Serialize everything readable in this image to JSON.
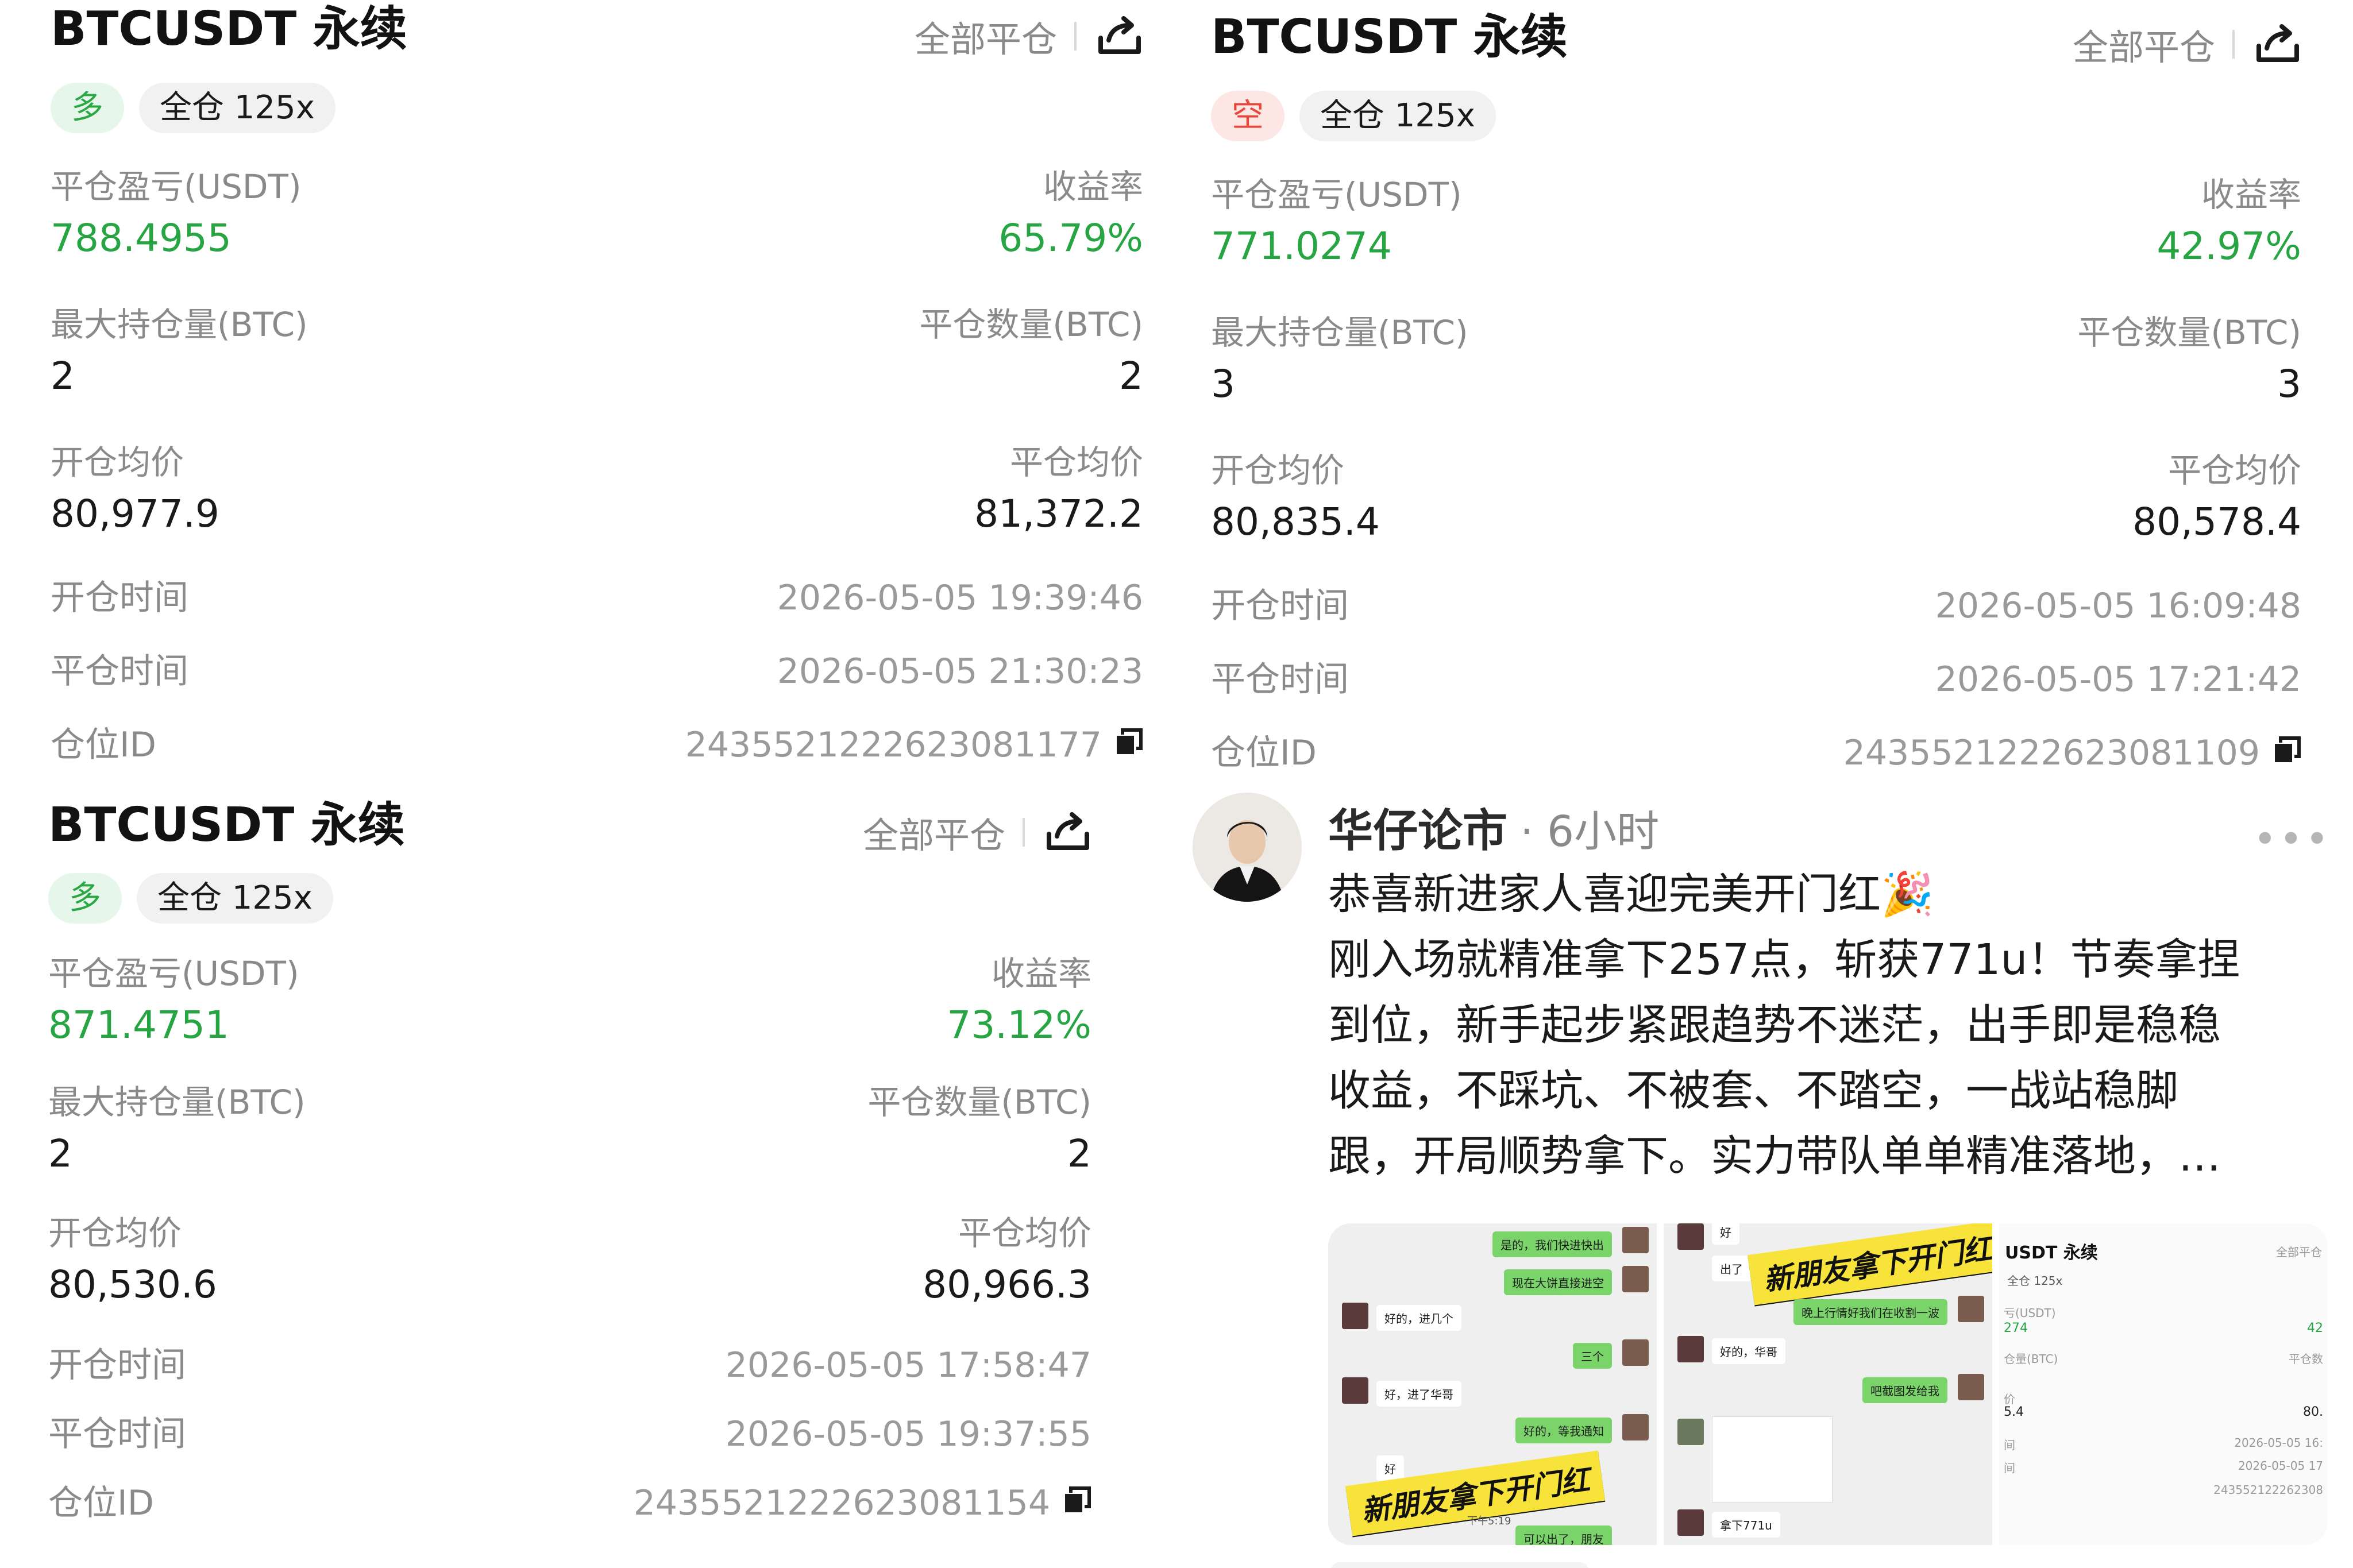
{
  "positions": [
    {
      "title": "BTCUSDT 永续",
      "close_all": "全部平仓",
      "side": "多",
      "mode": "全仓 125x",
      "pnl_label": "平仓盈亏(USDT)",
      "pnl_value": "788.4955",
      "roi_label": "收益率",
      "roi_value": "65.79%",
      "max_pos_label": "最大持仓量(BTC)",
      "max_pos_value": "2",
      "close_qty_label": "平仓数量(BTC)",
      "close_qty_value": "2",
      "open_avg_label": "开仓均价",
      "open_avg_value": "80,977.9",
      "close_avg_label": "平仓均价",
      "close_avg_value": "81,372.2",
      "open_time_label": "开仓时间",
      "open_time_value": "2026-05-05 19:39:46",
      "close_time_label": "平仓时间",
      "close_time_value": "2026-05-05 21:30:23",
      "pos_id_label": "仓位ID",
      "pos_id_value": "2435521222623081177"
    },
    {
      "title": "BTCUSDT 永续",
      "close_all": "全部平仓",
      "side": "空",
      "mode": "全仓 125x",
      "pnl_label": "平仓盈亏(USDT)",
      "pnl_value": "771.0274",
      "roi_label": "收益率",
      "roi_value": "42.97%",
      "max_pos_label": "最大持仓量(BTC)",
      "max_pos_value": "3",
      "close_qty_label": "平仓数量(BTC)",
      "close_qty_value": "3",
      "open_avg_label": "开仓均价",
      "open_avg_value": "80,835.4",
      "close_avg_label": "平仓均价",
      "close_avg_value": "80,578.4",
      "open_time_label": "开仓时间",
      "open_time_value": "2026-05-05 16:09:48",
      "close_time_label": "平仓时间",
      "close_time_value": "2026-05-05 17:21:42",
      "pos_id_label": "仓位ID",
      "pos_id_value": "2435521222623081109"
    },
    {
      "title": "BTCUSDT 永续",
      "close_all": "全部平仓",
      "side": "多",
      "mode": "全仓 125x",
      "pnl_label": "平仓盈亏(USDT)",
      "pnl_value": "871.4751",
      "roi_label": "收益率",
      "roi_value": "73.12%",
      "max_pos_label": "最大持仓量(BTC)",
      "max_pos_value": "2",
      "close_qty_label": "平仓数量(BTC)",
      "close_qty_value": "2",
      "open_avg_label": "开仓均价",
      "open_avg_value": "80,530.6",
      "close_avg_label": "平仓均价",
      "close_avg_value": "80,966.3",
      "open_time_label": "开仓时间",
      "open_time_value": "2026-05-05 17:58:47",
      "close_time_label": "平仓时间",
      "close_time_value": "2026-05-05 19:37:55",
      "pos_id_label": "仓位ID",
      "pos_id_value": "2435521222623081154"
    }
  ],
  "post": {
    "author": "华仔论市",
    "time": "· 6小时",
    "more": "•••",
    "lines": [
      "恭喜新进家人喜迎完美开门红🎉",
      "刚入场就精准拿下257点，斩获771u！节奏拿捏",
      "到位，新手起步紧跟趋势不迷茫，出手即是稳稳",
      "收益，不踩坑、不被套、不踏空，一战站稳脚",
      "跟，开局顺势拿下。实力带队单单精准落地，…"
    ],
    "thumb1": {
      "msgs": [
        "是的，我们快进快出",
        "现在大饼直接进空",
        "好的，进几个",
        "三个",
        "好，进了华哥",
        "好的，等我通知",
        "好"
      ],
      "sticker": "新朋友拿下开门红",
      "time": "下午5:19",
      "tail": "可以出了，朋友"
    },
    "thumb2": {
      "msgs": [
        "好",
        "出了",
        "晚上行情好我们在收割一波",
        "好的，华哥",
        "吧截图发给我",
        "拿下771u"
      ],
      "sticker": "新朋友拿下开门红"
    },
    "thumb3": {
      "title": "USDT 永续",
      "close_all": "全部平仓",
      "mode": "全仓 125x",
      "pnl_label": "亏(USDT)",
      "pnl_value": "274",
      "roi_value": "42",
      "qty_label": "仓量(BTC)",
      "close_qty_label": "平仓数",
      "avg_label": "价",
      "avg_value": "5.4",
      "close_avg_value": "80.",
      "time1_label": "间",
      "time1_value": "2026-05-05 16:",
      "time2_label": "间",
      "time2_value": "2026-05-05 17",
      "id_value": "243552122262308"
    }
  },
  "colors": {
    "green": "#27a543",
    "red": "#e8463a",
    "muted": "#8a8a8a"
  }
}
